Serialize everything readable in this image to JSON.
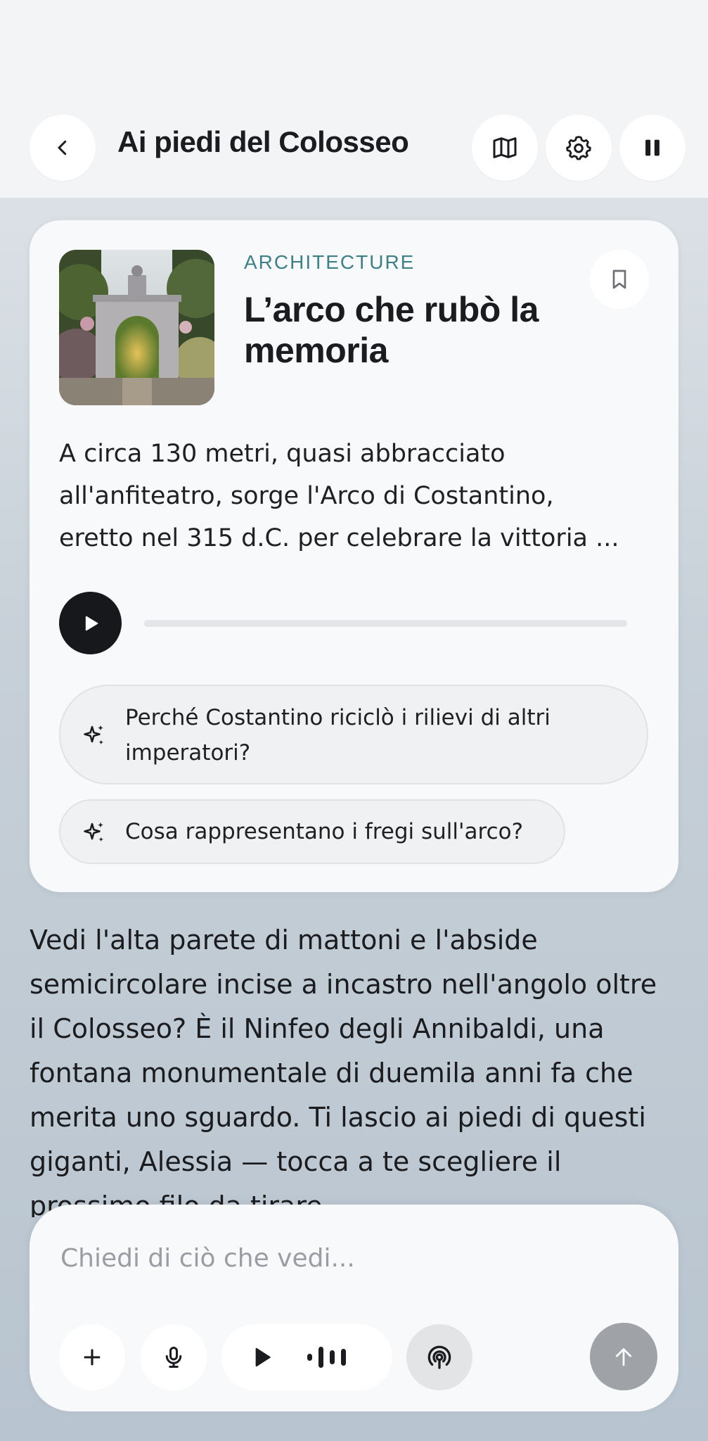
{
  "header": {
    "title": "Ai piedi del Colosseo",
    "back_icon": "chevron-left-icon",
    "map_icon": "map-icon",
    "settings_icon": "gear-icon",
    "pause_icon": "pause-icon"
  },
  "story_card": {
    "category": "ARCHITECTURE",
    "title": "L’arco che rubò la memoria",
    "body_lines": [
      "A circa 130 metri, quasi abbracciato",
      "all'anfiteatro, sorge l'Arco di Costantino,",
      "eretto nel 315 d.C. per celebrare la vittoria ..."
    ],
    "audio_progress": 0,
    "suggestions": [
      {
        "lines": [
          "Perché Costantino riciclò i rilievi di altri",
          "imperatori?"
        ]
      },
      {
        "lines": [
          "Cosa rappresentano i fregi sull'arco?"
        ]
      }
    ]
  },
  "transcript": {
    "lines": [
      "Vedi l'alta parete di mattoni e l'abside",
      "semicircolare incise a incastro nell'angolo oltre",
      "il Colosseo? È il Ninfeo degli Annibaldi, una",
      "fontana monumentale di duemila anni fa che",
      "merita uno sguardo. Ti lascio ai piedi di questi",
      "giganti, Alessia — tocca a te scegliere il",
      "prossimo filo da tirare."
    ]
  },
  "composer": {
    "placeholder": "Chiedi di ciò che vedi...",
    "add_icon": "plus-icon",
    "mic_icon": "microphone-icon",
    "play_icon": "play-icon",
    "waveform_icon": "waveform-icon",
    "live_icon": "broadcast-icon",
    "send_icon": "arrow-up-icon"
  }
}
